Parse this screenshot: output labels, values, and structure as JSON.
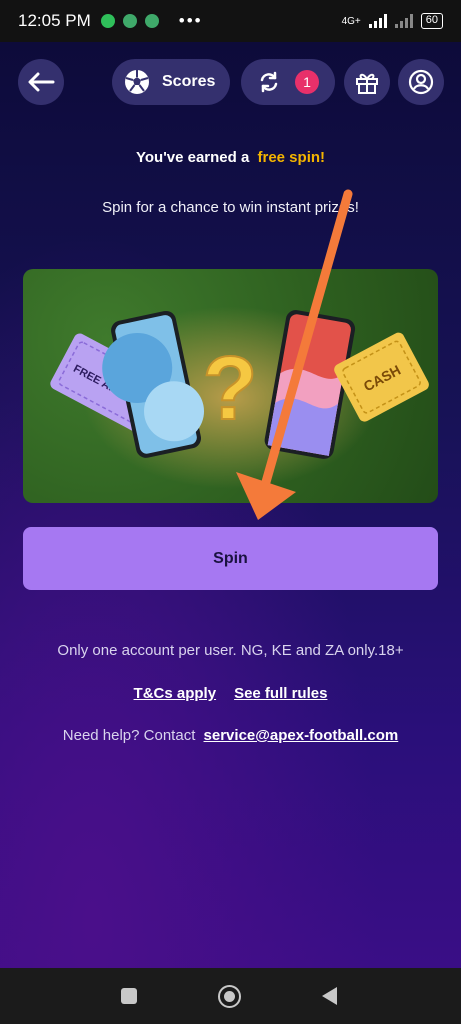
{
  "status": {
    "time": "12:05 PM",
    "network": "4G+",
    "battery": "60"
  },
  "topbar": {
    "scores_label": "Scores",
    "notifications_count": "1"
  },
  "promo": {
    "headline_prefix": "You've earned a",
    "headline_accent": "free spin!",
    "subtitle": "Spin for a chance to win instant prizes!",
    "ticket_left_text": "FREE AIRTIME",
    "ticket_right_text": "CASH"
  },
  "spin_button_label": "Spin",
  "terms": {
    "text": "Only one account per user. NG, KE and ZA only.18+",
    "tcs_link": "T&Cs apply",
    "rules_link": "See full rules"
  },
  "help": {
    "prefix": "Need help? Contact",
    "email": "service@apex-football.com"
  },
  "colors": {
    "accent": "#f4b400",
    "spin_button": "#a678f2",
    "badge": "#e8306a",
    "arrow": "#f47a3a"
  }
}
